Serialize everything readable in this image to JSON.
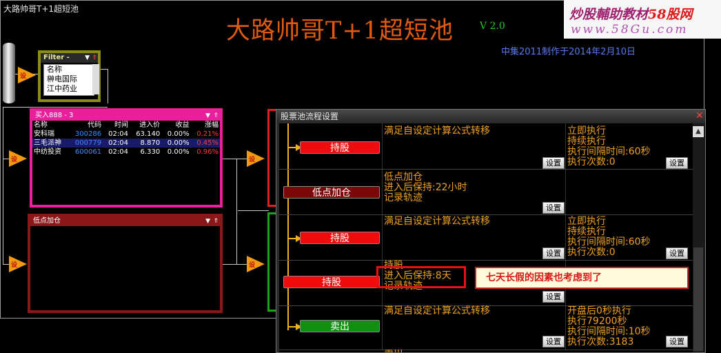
{
  "window": {
    "title": "大路帅哥T+1超短池"
  },
  "header": {
    "big_title": "大路帅哥T+1超短池",
    "version": "V 2.0",
    "subtitle": "中集2011制作于2014年2月10日"
  },
  "watermark": {
    "line1_a": "炒股輔助教材",
    "line1_b": "58股网",
    "line2": "www.58Gu.com"
  },
  "process_label": "设",
  "filter_panel": {
    "title": "Filter - ",
    "header": "名称",
    "items": [
      "榊电国际",
      "江中药业"
    ]
  },
  "buy_panel": {
    "title": "买入888 - 3",
    "columns": [
      "名称",
      "代码",
      "时间",
      "进入价",
      "收益",
      "涨幅"
    ],
    "rows": [
      {
        "name": "安科瑞",
        "code": "300286",
        "time": "02:04",
        "price": "63.140",
        "gain": "0.00%",
        "change": "0.21%"
      },
      {
        "name": "三毛派神",
        "code": "000779",
        "time": "02:04",
        "price": "8.870",
        "gain": "0.00%",
        "change": "0.45%"
      },
      {
        "name": "中纺投资",
        "code": "600061",
        "time": "02:04",
        "price": "6.330",
        "gain": "0.00%",
        "change": "0.96%"
      }
    ]
  },
  "dip_panel": {
    "title": "低点加仓"
  },
  "dialog": {
    "title": "股票池流程设置",
    "close": "✕",
    "set_label": "设置",
    "steps": [
      {
        "button": "持股",
        "color": "red",
        "condition": [
          "满足自设定计算公式转移"
        ],
        "action": [
          "立即执行",
          "持续执行",
          "执行间隔时间:60秒",
          "执行次数:0"
        ]
      },
      {
        "button": "低点加仓",
        "color": "dark",
        "condition": [
          "低点加仓",
          "进入后保持:22小时",
          "记录轨迹"
        ],
        "action": []
      },
      {
        "button": "持股",
        "color": "red",
        "condition": [
          "满足自设定计算公式转移"
        ],
        "action": [
          "立即执行",
          "持续执行",
          "执行间隔时间:60秒",
          "执行次数:0"
        ]
      },
      {
        "button": "持股",
        "color": "red",
        "condition": [
          "持股",
          "进入后保持:8天",
          "记录轨迹"
        ],
        "action": []
      },
      {
        "button": "卖出",
        "color": "green",
        "condition": [
          "满足自设定计算公式转移"
        ],
        "action": [
          "开盘后0秒执行",
          "执行79200秒",
          "执行间隔时间:10秒",
          "执行次数:3183"
        ]
      }
    ],
    "bottom_partial": "卖出"
  },
  "annotation": {
    "callout": "七天长假的因素也考虑到了"
  },
  "colors": {
    "accent_orange": "#e05a10",
    "buy_border": "#e8209a",
    "dip_border": "#8a1818",
    "step_text": "#f0a020"
  }
}
